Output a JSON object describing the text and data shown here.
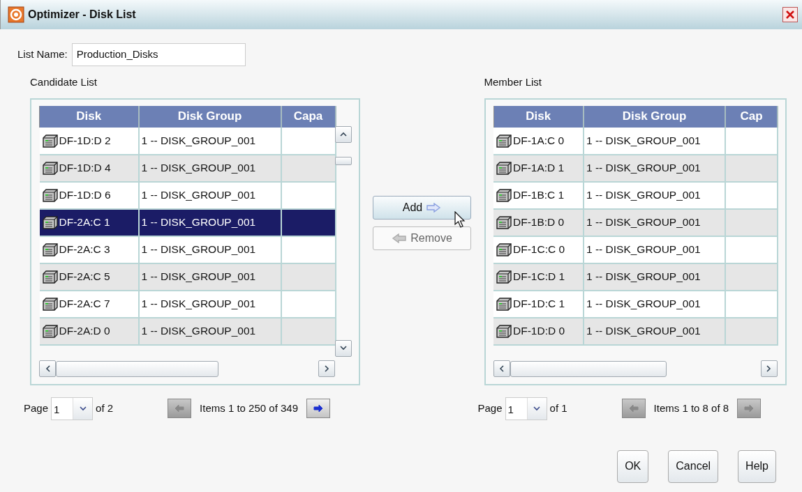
{
  "window": {
    "title": "Optimizer - Disk List"
  },
  "list_name": {
    "label": "List Name:",
    "value": "Production_Disks"
  },
  "candidate_list": {
    "label": "Candidate List",
    "columns": [
      "Disk",
      "Disk Group",
      "Capa"
    ],
    "rows": [
      {
        "disk": "DF-1D:D 2",
        "disk_group": "1 -- DISK_GROUP_001",
        "selected": false
      },
      {
        "disk": "DF-1D:D 4",
        "disk_group": "1 -- DISK_GROUP_001",
        "selected": false
      },
      {
        "disk": "DF-1D:D 6",
        "disk_group": "1 -- DISK_GROUP_001",
        "selected": false
      },
      {
        "disk": "DF-2A:C 1",
        "disk_group": "1 -- DISK_GROUP_001",
        "selected": true
      },
      {
        "disk": "DF-2A:C 3",
        "disk_group": "1 -- DISK_GROUP_001",
        "selected": false
      },
      {
        "disk": "DF-2A:C 5",
        "disk_group": "1 -- DISK_GROUP_001",
        "selected": false
      },
      {
        "disk": "DF-2A:C 7",
        "disk_group": "1 -- DISK_GROUP_001",
        "selected": false
      },
      {
        "disk": "DF-2A:D 0",
        "disk_group": "1 -- DISK_GROUP_001",
        "selected": false
      }
    ],
    "pager": {
      "label": "Page",
      "page": "1",
      "of": "of 2",
      "items": "Items 1 to 250 of 349",
      "prev_disabled": true,
      "next_disabled": false
    }
  },
  "transfer_buttons": [
    {
      "kind": "add",
      "label": "Add",
      "disabled": false
    },
    {
      "kind": "remove",
      "label": "Remove",
      "disabled": true
    }
  ],
  "member_list": {
    "label": "Member List",
    "columns": [
      "Disk",
      "Disk Group",
      "Cap"
    ],
    "rows": [
      {
        "disk": "DF-1A:C 0",
        "disk_group": "1 -- DISK_GROUP_001",
        "selected": false
      },
      {
        "disk": "DF-1A:D 1",
        "disk_group": "1 -- DISK_GROUP_001",
        "selected": false
      },
      {
        "disk": "DF-1B:C 1",
        "disk_group": "1 -- DISK_GROUP_001",
        "selected": false
      },
      {
        "disk": "DF-1B:D 0",
        "disk_group": "1 -- DISK_GROUP_001",
        "selected": false
      },
      {
        "disk": "DF-1C:C 0",
        "disk_group": "1 -- DISK_GROUP_001",
        "selected": false
      },
      {
        "disk": "DF-1C:D 1",
        "disk_group": "1 -- DISK_GROUP_001",
        "selected": false
      },
      {
        "disk": "DF-1D:C 1",
        "disk_group": "1 -- DISK_GROUP_001",
        "selected": false
      },
      {
        "disk": "DF-1D:D 0",
        "disk_group": "1 -- DISK_GROUP_001",
        "selected": false
      }
    ],
    "pager": {
      "label": "Page",
      "page": "1",
      "of": "of 1",
      "items": "Items 1 to 8 of 8",
      "prev_disabled": true,
      "next_disabled": true
    }
  },
  "buttons": [
    "OK",
    "Cancel",
    "Help"
  ]
}
